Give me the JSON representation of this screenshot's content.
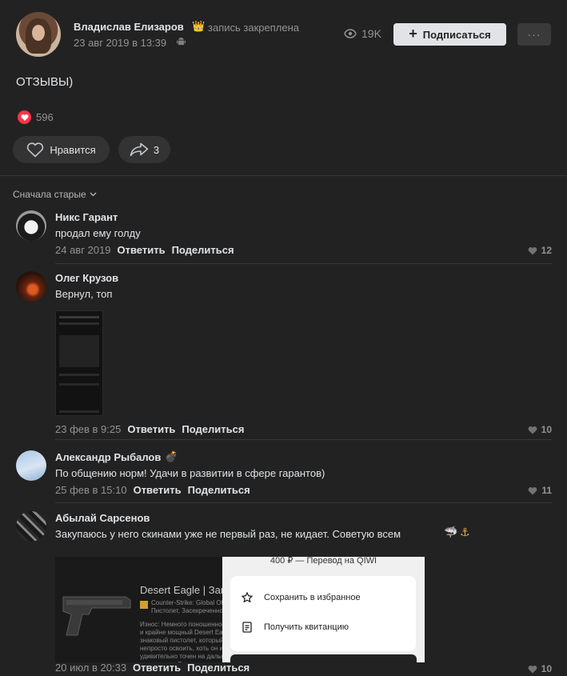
{
  "post": {
    "author": "Владислав Елизаров",
    "pinned": "запись закреплена",
    "date": "23 авг 2019 в 13:39",
    "views": "19K",
    "subscribe_label": "Подписаться",
    "more_label": "···",
    "text": "ОТЗЫВЫ)",
    "reactions_count": "596",
    "like_label": "Нравится",
    "shares_count": "3"
  },
  "sort_label": "Сначала старые",
  "colors": {
    "background": "#222222",
    "like_heart": "#ff3347",
    "muted": "#939393"
  },
  "comments": [
    {
      "author": "Никс Гарант",
      "text": "продал ему голду",
      "date": "24 авг 2019",
      "reply": "Ответить",
      "share": "Поделиться",
      "likes": "12"
    },
    {
      "author": "Олег Крузов",
      "text": "Вернул, топ",
      "date": "23 фев в 9:25",
      "reply": "Ответить",
      "share": "Поделиться",
      "likes": "10"
    },
    {
      "author": "Александр Рыбалов",
      "text": "По общению норм! Удачи в развитии в сфере гарантов)",
      "date": "25 фев в 15:10",
      "reply": "Ответить",
      "share": "Поделиться",
      "likes": "11"
    },
    {
      "author": "Абылай Сарсенов",
      "text": "Закупаюсь у него скинами уже не первый раз, не кидает. Советую всем",
      "date": "20 июл в 20:33",
      "reply": "Ответить",
      "share": "Поделиться",
      "likes": "10"
    }
  ],
  "attachments": {
    "deagle": {
      "title": "Desert Eagle | Заговор",
      "subtitle": "Counter-Strike: Global Offensive Пистолет, Засекреченное",
      "description": "Износ: Немного поношенное  Дорогой и крайне мощный Desert Eagle — знаковый пистолет, который непросто освоить, хоть он и удивительно точен на дальних дистанциях. Раскрашено"
    },
    "qiwi": {
      "top": "400 ₽ — Перевод на QIWI",
      "save": "Сохранить в избранное",
      "receipt": "Получить квитанцию"
    }
  }
}
